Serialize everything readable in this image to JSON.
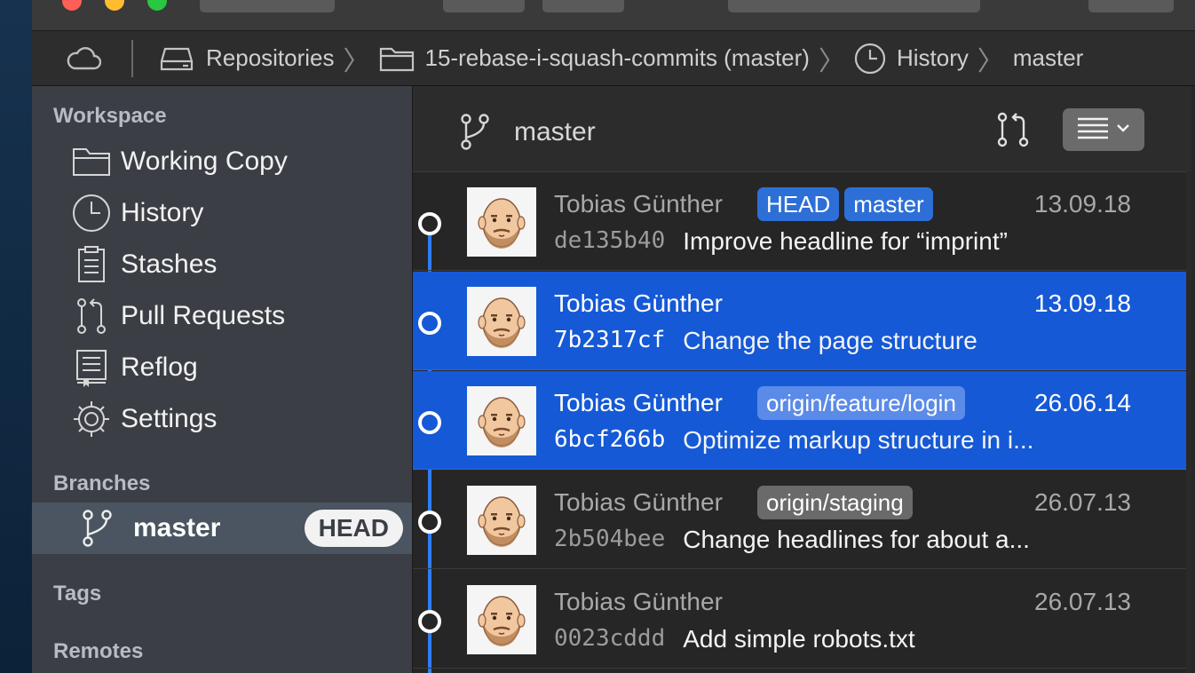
{
  "breadcrumb": {
    "repositories": "Repositories",
    "repo": "15-rebase-i-squash-commits (master)",
    "history": "History",
    "branch": "master"
  },
  "sidebar": {
    "workspace_title": "Workspace",
    "items": [
      {
        "label": "Working Copy",
        "icon": "folder-icon"
      },
      {
        "label": "History",
        "icon": "clock-icon"
      },
      {
        "label": "Stashes",
        "icon": "clipboard-icon"
      },
      {
        "label": "Pull Requests",
        "icon": "pull-request-icon"
      },
      {
        "label": "Reflog",
        "icon": "book-icon"
      },
      {
        "label": "Settings",
        "icon": "gear-icon"
      }
    ],
    "branches_title": "Branches",
    "branch": {
      "label": "master",
      "badge": "HEAD"
    },
    "tags_title": "Tags",
    "remotes_title": "Remotes"
  },
  "main": {
    "branch_title": "master",
    "commits": [
      {
        "author": "Tobias Günther",
        "date": "13.09.18",
        "hash": "de135b40",
        "subject": "Improve headline for “imprint”",
        "tags": [
          "HEAD",
          "master"
        ],
        "selected": false
      },
      {
        "author": "Tobias Günther",
        "date": "13.09.18",
        "hash": "7b2317cf",
        "subject": "Change the page structure",
        "tags": [],
        "selected": true
      },
      {
        "author": "Tobias Günther",
        "date": "26.06.14",
        "hash": "6bcf266b",
        "subject": "Optimize markup structure in i...",
        "tags": [
          "origin/feature/login"
        ],
        "selected": true
      },
      {
        "author": "Tobias Günther",
        "date": "26.07.13",
        "hash": "2b504bee",
        "subject": "Change headlines for about a...",
        "tags": [
          "origin/staging"
        ],
        "selected": false
      },
      {
        "author": "Tobias Günther",
        "date": "26.07.13",
        "hash": "0023cddd",
        "subject": "Add simple robots.txt",
        "tags": [],
        "selected": false
      }
    ]
  },
  "colors": {
    "selection": "#1559d6",
    "tag_local": "#2d6fd6",
    "tag_remote_on_selection": "#5b8be8",
    "tag_remote": "#6a6a6a",
    "graph": "#2f7df6"
  }
}
